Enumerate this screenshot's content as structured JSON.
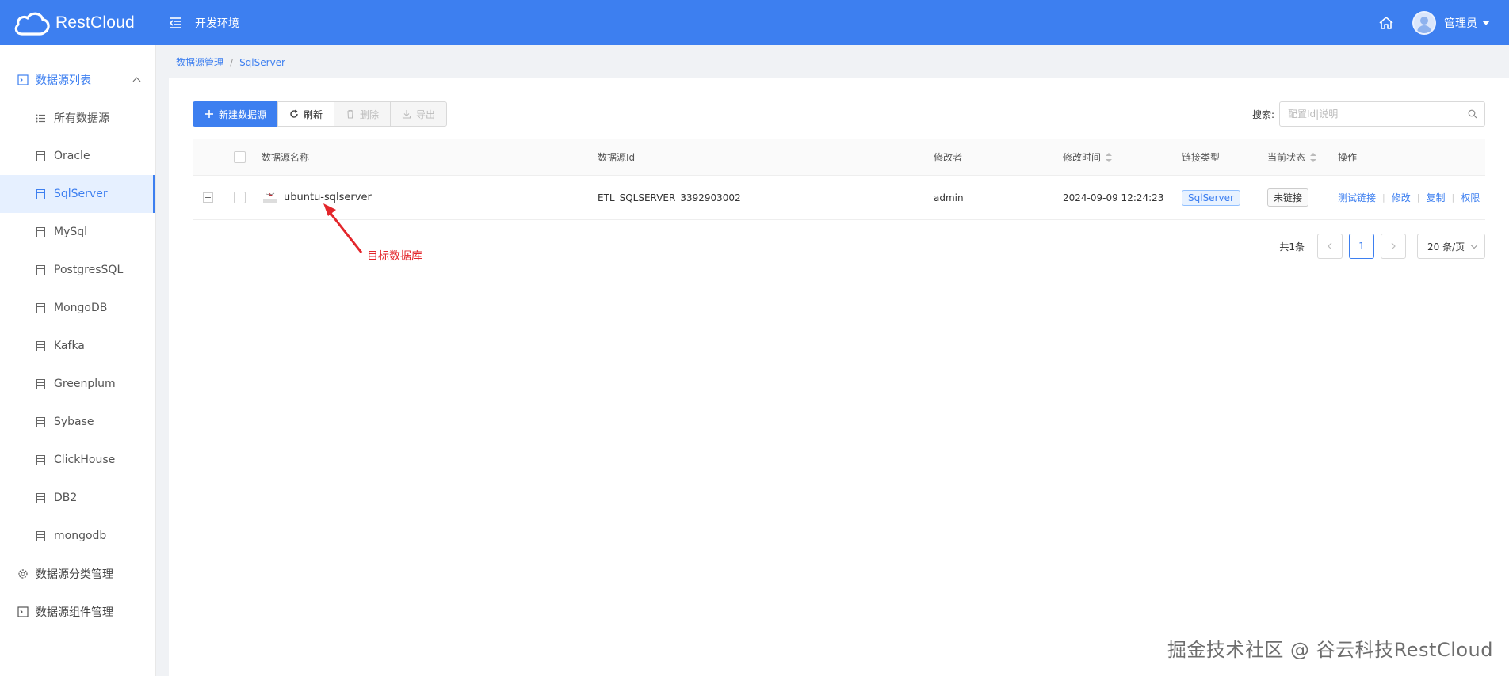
{
  "header": {
    "logo_text": "RestCloud",
    "env": "开发环境",
    "user": "管理员"
  },
  "sidebar": {
    "groups": [
      {
        "label": "数据源列表"
      },
      {
        "label": "数据源分类管理"
      },
      {
        "label": "数据源组件管理"
      }
    ],
    "items": [
      {
        "label": "所有数据源"
      },
      {
        "label": "Oracle"
      },
      {
        "label": "SqlServer"
      },
      {
        "label": "MySql"
      },
      {
        "label": "PostgresSQL"
      },
      {
        "label": "MongoDB"
      },
      {
        "label": "Kafka"
      },
      {
        "label": "Greenplum"
      },
      {
        "label": "Sybase"
      },
      {
        "label": "ClickHouse"
      },
      {
        "label": "DB2"
      },
      {
        "label": "mongodb"
      }
    ],
    "active_item": "SqlServer"
  },
  "breadcrumb": {
    "items": [
      "数据源管理",
      "SqlServer"
    ],
    "separator": "/"
  },
  "toolbar": {
    "new_label": "新建数据源",
    "refresh_label": "刷新",
    "delete_label": "删除",
    "export_label": "导出"
  },
  "search": {
    "label": "搜索:",
    "placeholder": "配置Id|说明"
  },
  "table": {
    "headers": {
      "name": "数据源名称",
      "id": "数据源Id",
      "modifier": "修改者",
      "modified_time": "修改时间",
      "type": "链接类型",
      "status": "当前状态",
      "ops": "操作"
    },
    "rows": [
      {
        "expand": "+",
        "name": "ubuntu-sqlserver",
        "id": "ETL_SQLSERVER_3392903002",
        "modifier": "admin",
        "modified_time": "2024-09-09 12:24:23",
        "type": "SqlServer",
        "status": "未链接",
        "ops": [
          "测试链接",
          "修改",
          "复制",
          "权限"
        ]
      }
    ]
  },
  "pagination": {
    "total": "共1条",
    "current_page": "1",
    "page_size": "20 条/页"
  },
  "annotation": {
    "text": "目标数据库",
    "color": "#e3262b"
  },
  "watermark": "掘金技术社区 @ 谷云科技RestCloud",
  "colors": {
    "primary": "#3d7ff0"
  }
}
